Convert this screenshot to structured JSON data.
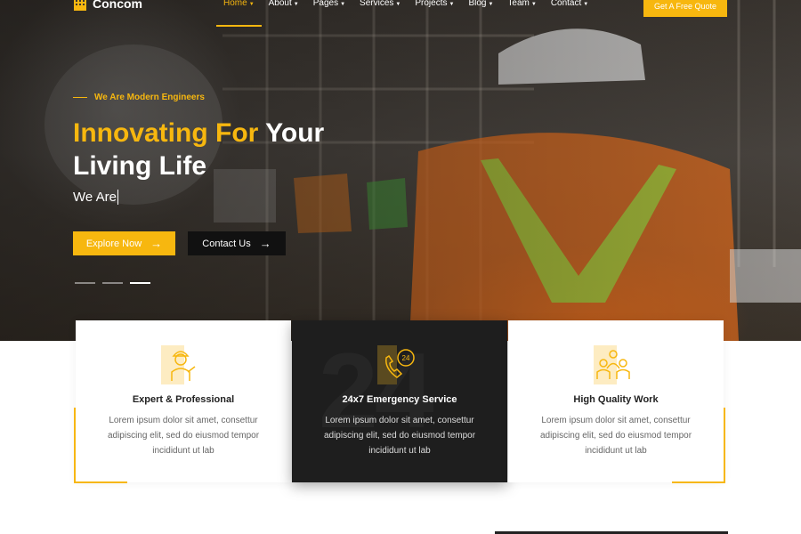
{
  "brand": {
    "name": "Concom"
  },
  "nav": {
    "items": [
      {
        "label": "Home",
        "active": true
      },
      {
        "label": "About",
        "active": false
      },
      {
        "label": "Pages",
        "active": false
      },
      {
        "label": "Services",
        "active": false
      },
      {
        "label": "Projects",
        "active": false
      },
      {
        "label": "Blog",
        "active": false
      },
      {
        "label": "Team",
        "active": false
      },
      {
        "label": "Contact",
        "active": false
      }
    ],
    "quote_button": "Get A Free Quote"
  },
  "hero": {
    "tagline": "We Are Modern Engineers",
    "headline_accent": "Innovating For",
    "headline_rest": "Your",
    "headline_line2": "Living Life",
    "typed_text": "We Are",
    "explore_button": "Explore Now",
    "contact_button": "Contact Us",
    "slide_count": 3,
    "active_slide": 3
  },
  "features": [
    {
      "title": "Expert & Professional",
      "text": "Lorem ipsum dolor sit amet, consettur adipiscing elit, sed do eiusmod tempor incididunt ut lab",
      "icon": "engineer-icon"
    },
    {
      "title": "24x7 Emergency Service",
      "text": "Lorem ipsum dolor sit amet, consettur adipiscing elit, sed do eiusmod tempor incididunt ut lab",
      "icon": "phone-24-icon",
      "background_number": "24"
    },
    {
      "title": "High Quality Work",
      "text": "Lorem ipsum dolor sit amet, consettur adipiscing elit, sed do eiusmod tempor incididunt ut lab",
      "icon": "team-workers-icon"
    }
  ],
  "colors": {
    "accent": "#f7b70f",
    "dark": "#1e1e1e",
    "text_muted": "#666666"
  }
}
